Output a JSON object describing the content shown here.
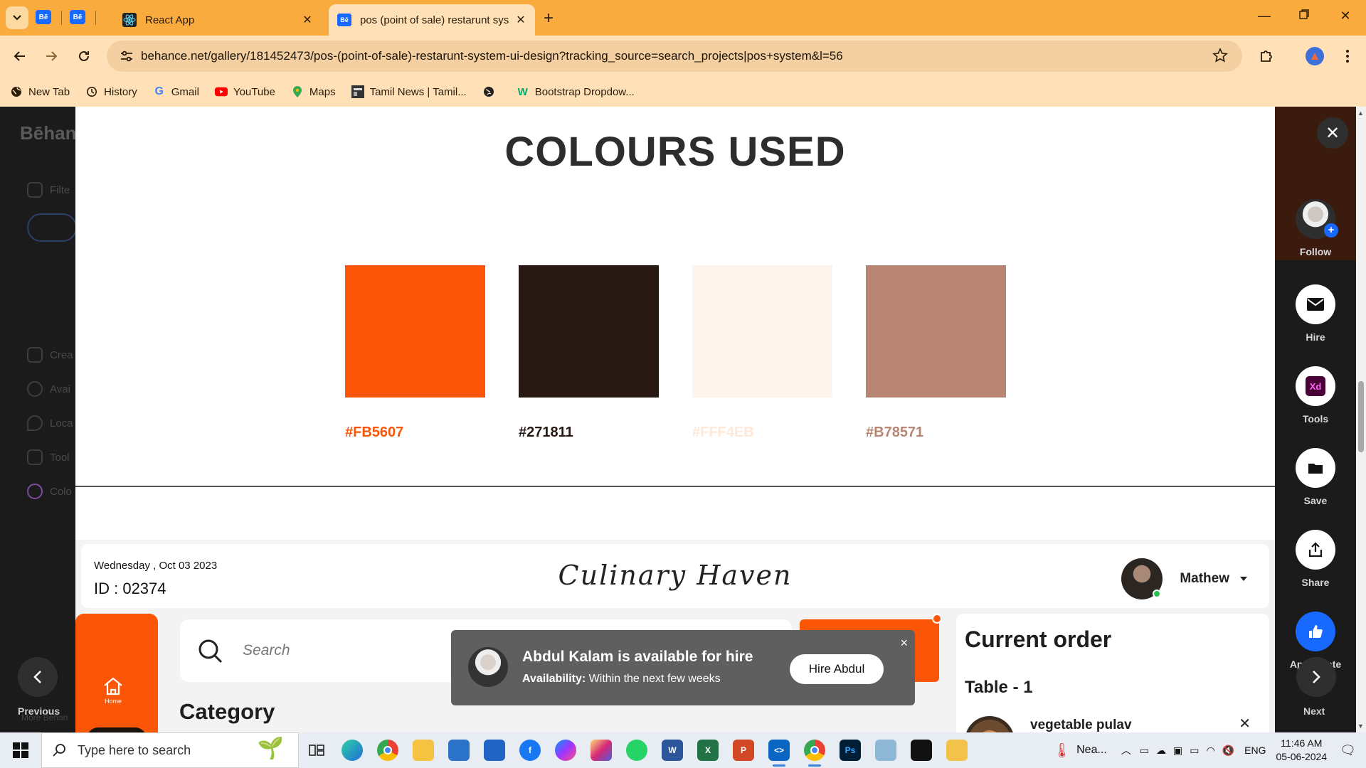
{
  "browser": {
    "tabs": [
      {
        "title": "React App",
        "active": false
      },
      {
        "title": "pos (point of sale) restarunt sys",
        "active": true
      }
    ],
    "pinned_tab_icon": "Bē",
    "new_tab_symbol": "+",
    "address": "behance.net/gallery/181452473/pos-(point-of-sale)-restarunt-system-ui-design?tracking_source=search_projects|pos+system&l=56",
    "bookmarks": [
      "New Tab",
      "History",
      "Gmail",
      "YouTube",
      "Maps",
      "Tamil News | Tamil...",
      "Bootstrap Dropdow..."
    ],
    "colors": {
      "tabstrip": "#f9ab3d",
      "toolbar": "#ffe0b7"
    }
  },
  "behance_sidebar": {
    "logo": "Bēhan",
    "items": [
      "Filte",
      "Crea",
      "Avai",
      "Loca",
      "Tool",
      "Colo"
    ],
    "more": "More Behan"
  },
  "project": {
    "section_title": "COLOURS USED",
    "swatches": [
      {
        "hex": "#FB5607",
        "label": "#FB5607",
        "label_color": "#FB5607"
      },
      {
        "hex": "#271811",
        "label": "#271811",
        "label_color": "#271811"
      },
      {
        "hex": "#FFF4EB",
        "label": "#FFF4EB",
        "label_color": "#FFE8D8"
      },
      {
        "hex": "#B78571",
        "label": "#B78571",
        "label_color": "#B78571"
      }
    ]
  },
  "pos_app": {
    "date": "Wednesday , Oct 03 2023",
    "order_id": "ID : 02374",
    "brand": "Culinary Haven",
    "user_name": "Mathew",
    "home_label": "Home",
    "search_placeholder": "Search",
    "category_title": "Category",
    "current_order_title": "Current order",
    "table_label": "Table - 1",
    "order_item": "vegetable pulav",
    "remove_symbol": "✕"
  },
  "hire_toast": {
    "title": "Abdul Kalam is available for hire",
    "availability_label": "Availability:",
    "availability_value": "Within the next few weeks",
    "button": "Hire Abdul",
    "close": "×"
  },
  "right_rail": {
    "close": "✕",
    "follow": "Follow",
    "hire": "Hire",
    "tools": "Tools",
    "tools_badge": "Xd",
    "save": "Save",
    "share": "Share",
    "appreciate": "Appreciate",
    "next": "Next",
    "previous": "Previous"
  },
  "taskbar": {
    "search_placeholder": "Type here to search",
    "weather": "Nea...",
    "language": "ENG",
    "time": "11:46 AM",
    "date": "05-06-2024"
  }
}
